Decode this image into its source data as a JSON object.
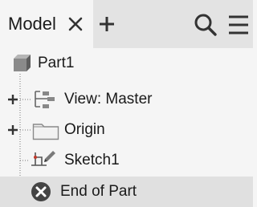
{
  "browser": {
    "tab": {
      "label": "Model",
      "close_icon": "close-icon"
    },
    "toolbar": {
      "add_icon": "plus-icon",
      "search_icon": "search-icon",
      "menu_icon": "hamburger-menu-icon"
    }
  },
  "tree": {
    "items": [
      {
        "label": "Part1",
        "icon": "part-cube-icon"
      },
      {
        "label": "View: Master",
        "icon": "view-rep-icon",
        "expandable": true
      },
      {
        "label": "Origin",
        "icon": "folder-icon",
        "expandable": true
      },
      {
        "label": "Sketch1",
        "icon": "sketch-icon"
      },
      {
        "label": "End of Part",
        "icon": "end-of-part-icon"
      }
    ]
  }
}
